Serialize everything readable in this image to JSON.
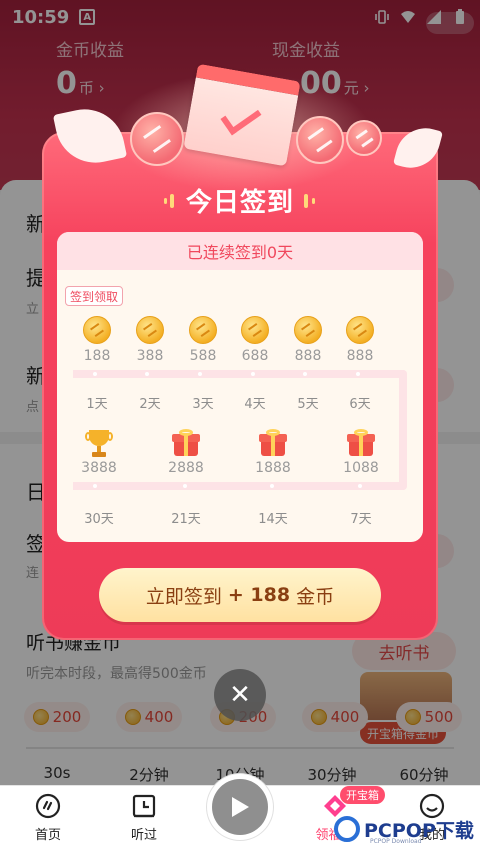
{
  "status_bar": {
    "time": "10:59",
    "notification_letter": "A"
  },
  "header": {
    "coin_earnings_label": "金币收益",
    "coin_value": "0",
    "coin_unit": "币 ›",
    "cash_earnings_label": "现金收益",
    "cash_value": "00",
    "cash_unit": "元 ›"
  },
  "background": {
    "side_texts": [
      "新",
      "提",
      "新",
      "日",
      "签"
    ],
    "side_subs": [
      "立",
      "点",
      "连"
    ],
    "listen_task": {
      "title": "听书赚金币",
      "subtitle": "听完本时段，最高得500金币",
      "go_button": "去听书",
      "treasure_tag": "开宝箱得金币",
      "rewards": [
        "200",
        "400",
        "200",
        "400",
        "500"
      ],
      "time_labels": [
        "30s",
        "2分钟",
        "10分钟",
        "30分钟",
        "60分钟"
      ]
    }
  },
  "dialog": {
    "title": "今日签到",
    "streak_text": "已连续签到0天",
    "tag": "签到领取",
    "top_row": [
      {
        "amount": "188",
        "day": "1天"
      },
      {
        "amount": "388",
        "day": "2天"
      },
      {
        "amount": "588",
        "day": "3天"
      },
      {
        "amount": "688",
        "day": "4天"
      },
      {
        "amount": "888",
        "day": "5天"
      },
      {
        "amount": "888",
        "day": "6天"
      }
    ],
    "bottom_row": [
      {
        "amount": "3888",
        "day": "30天",
        "icon": "trophy-icon"
      },
      {
        "amount": "2888",
        "day": "21天",
        "icon": "gift-icon"
      },
      {
        "amount": "1888",
        "day": "14天",
        "icon": "gift-icon"
      },
      {
        "amount": "1088",
        "day": "7天",
        "icon": "gift-icon"
      }
    ],
    "cta_prefix": "立即签到",
    "cta_bold": "+ 188",
    "cta_suffix": "金币",
    "close_symbol": "✕"
  },
  "bottom_nav": {
    "items": [
      {
        "label": "首页",
        "icon": "home-icon"
      },
      {
        "label": "听过",
        "icon": "history-icon"
      },
      {
        "label": "领福利",
        "icon": "welfare-icon"
      },
      {
        "label": "我的",
        "icon": "profile-icon"
      }
    ],
    "badge": "开宝箱",
    "play_icon": "play-icon"
  },
  "watermark": {
    "text": "PCPOP下载",
    "sub": "PCPOP Download"
  },
  "colors": {
    "dialog_red": "#ee3b58",
    "header_red": "#a5213d",
    "cta_gold": "#ffe1a1",
    "coin_gold": "#f4b025"
  }
}
